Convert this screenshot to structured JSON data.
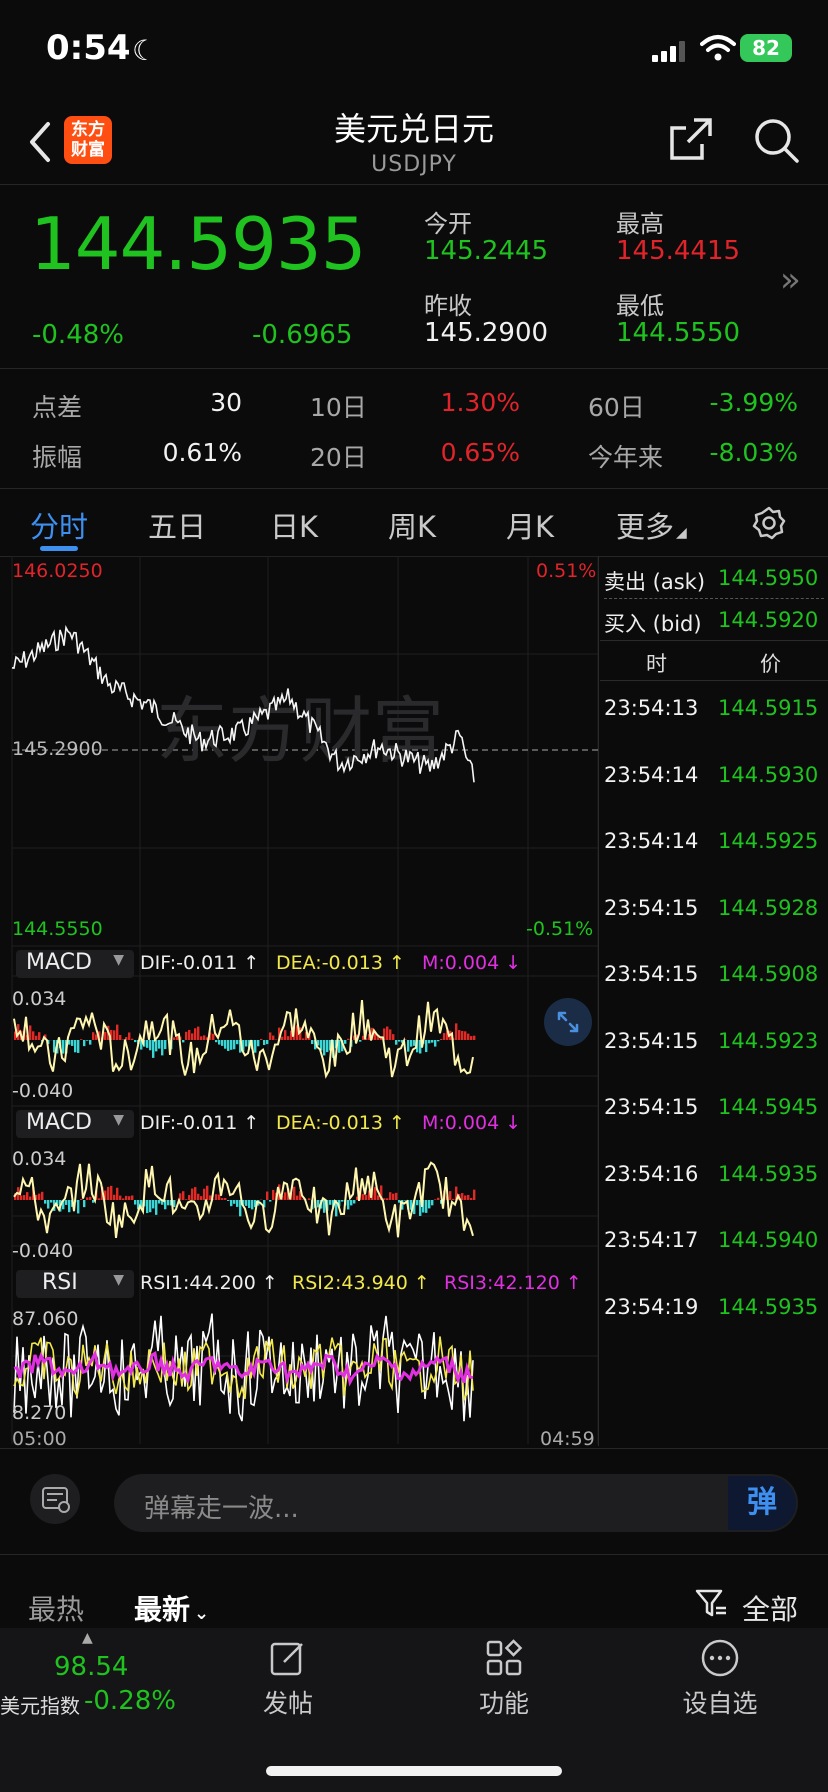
{
  "status": {
    "time": "0:54",
    "battery": "82"
  },
  "header": {
    "logo": "东方\n财富",
    "logo_l1": "东方",
    "logo_l2": "财富",
    "title": "美元兑日元",
    "subtitle": "USDJPY"
  },
  "quote": {
    "price": "144.5935",
    "change_pct": "-0.48%",
    "change": "-0.6965",
    "open_label": "今开",
    "open": "145.2445",
    "high_label": "最高",
    "high": "145.4415",
    "prev_close_label": "昨收",
    "prev_close": "145.2900",
    "low_label": "最低",
    "low": "144.5550"
  },
  "stats": {
    "spread_label": "点差",
    "spread": "30",
    "d10_label": "10日",
    "d10": "1.30%",
    "d60_label": "60日",
    "d60": "-3.99%",
    "amp_label": "振幅",
    "amp": "0.61%",
    "d20_label": "20日",
    "d20": "0.65%",
    "ytd_label": "今年来",
    "ytd": "-8.03%"
  },
  "tabs": [
    "分时",
    "五日",
    "日K",
    "周K",
    "月K",
    "更多"
  ],
  "chart": {
    "watermark": "东方财富",
    "top_price": "146.0250",
    "top_pct": "0.51%",
    "mid_price": "145.2900",
    "bottom_price": "144.5550",
    "bottom_pct": "-0.51%",
    "time_start": "05:00",
    "time_end": "04:59",
    "macd1": {
      "name": "MACD",
      "dif": "DIF:-0.011 ↑",
      "dea": "DEA:-0.013 ↑",
      "m": "M:0.004 ↓",
      "top": "0.034",
      "bottom": "-0.040"
    },
    "macd2": {
      "name": "MACD",
      "dif": "DIF:-0.011 ↑",
      "dea": "DEA:-0.013 ↑",
      "m": "M:0.004 ↓",
      "top": "0.034",
      "bottom": "-0.040"
    },
    "rsi": {
      "name": "RSI",
      "rsi1": "RSI1:44.200 ↑",
      "rsi2": "RSI2:43.940 ↑",
      "rsi3": "RSI3:42.120 ↑",
      "top": "87.060",
      "bottom": "8.270"
    }
  },
  "side": {
    "ask_label": "卖出 (ask)",
    "ask": "144.5950",
    "bid_label": "买入 (bid)",
    "bid": "144.5920",
    "time_header": "时",
    "price_header": "价",
    "ticks": [
      {
        "t": "23:54:13",
        "p": "144.5915"
      },
      {
        "t": "23:54:14",
        "p": "144.5930"
      },
      {
        "t": "23:54:14",
        "p": "144.5925"
      },
      {
        "t": "23:54:15",
        "p": "144.5928"
      },
      {
        "t": "23:54:15",
        "p": "144.5908"
      },
      {
        "t": "23:54:15",
        "p": "144.5923"
      },
      {
        "t": "23:54:15",
        "p": "144.5945"
      },
      {
        "t": "23:54:16",
        "p": "144.5935"
      },
      {
        "t": "23:54:17",
        "p": "144.5940"
      },
      {
        "t": "23:54:19",
        "p": "144.5935"
      }
    ]
  },
  "comment": {
    "placeholder": "弹幕走一波...",
    "send": "弹"
  },
  "filter": {
    "hot": "最热",
    "new": "最新",
    "all": "全部"
  },
  "bottom": {
    "index_value": "98.54",
    "index_label": "美元指数",
    "index_change": "-0.28%",
    "post": "发帖",
    "func": "功能",
    "watch": "设自选"
  },
  "colors": {
    "up": "#e0242a",
    "down": "#1fc21f",
    "accent": "#3d8ff0"
  },
  "icons": [
    "moon-icon",
    "signal-icon",
    "wifi-icon",
    "battery-icon",
    "back-chevron-icon",
    "share-icon",
    "search-icon",
    "settings-gear-icon",
    "expand-icon",
    "comment-icon",
    "filter-funnel-icon",
    "edit-icon",
    "grid-icon",
    "more-dots-icon"
  ]
}
